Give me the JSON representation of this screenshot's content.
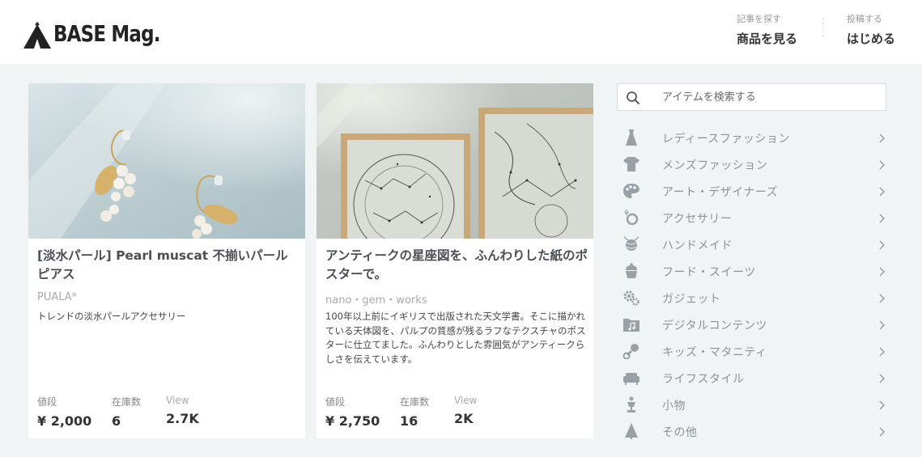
{
  "header": {
    "logo_text": "BASE Mag.",
    "nav": [
      {
        "small": "記事を探す",
        "big": "商品を見る"
      },
      {
        "small": "投稿する",
        "big": "はじめる"
      }
    ]
  },
  "products": [
    {
      "title": "[淡水パール] Pearl muscat 不揃いパールピアス",
      "shop": "PUALA*",
      "description": "トレンドの淡水パールアクセサリー",
      "price_label": "値段",
      "price": "¥ 2,000",
      "stock_label": "在庫数",
      "stock": "6",
      "view_label": "View",
      "views": "2.7K"
    },
    {
      "title": "アンティークの星座図を、ふんわりした紙のポスターで。",
      "shop": "nano・gem・works",
      "description": "100年以上前にイギリスで出版された天文学書。そこに描かれている天体図を、パルプの質感が残るラフなテクスチャのポスターに仕立てました。ふんわりとした雰囲気がアンティークらしさを伝えています。",
      "price_label": "値段",
      "price": "¥ 2,750",
      "stock_label": "在庫数",
      "stock": "16",
      "view_label": "View",
      "views": "2K"
    }
  ],
  "search": {
    "placeholder": "アイテムを検索する"
  },
  "categories": [
    {
      "label": "レディースファッション",
      "icon": "dress-icon"
    },
    {
      "label": "メンズファッション",
      "icon": "tshirt-icon"
    },
    {
      "label": "アート・デザイナーズ",
      "icon": "palette-icon"
    },
    {
      "label": "アクセサリー",
      "icon": "ring-icon"
    },
    {
      "label": "ハンドメイド",
      "icon": "yarn-icon"
    },
    {
      "label": "フード・スイーツ",
      "icon": "cupcake-icon"
    },
    {
      "label": "ガジェット",
      "icon": "gears-icon"
    },
    {
      "label": "デジタルコンテンツ",
      "icon": "music-folder-icon"
    },
    {
      "label": "キッズ・マタニティ",
      "icon": "rattle-icon"
    },
    {
      "label": "ライフスタイル",
      "icon": "sofa-icon"
    },
    {
      "label": "小物",
      "icon": "trophy-icon"
    },
    {
      "label": "その他",
      "icon": "tree-icon"
    }
  ],
  "colors": {
    "background": "#f0f4f5",
    "icon_gray": "#9aa0a5",
    "text_gray": "#8d9296"
  }
}
